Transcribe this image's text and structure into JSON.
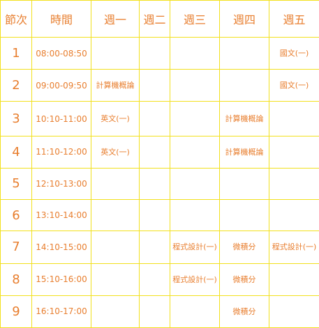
{
  "headers": [
    "節次",
    "時間",
    "週一",
    "週二",
    "週三",
    "週四",
    "週五"
  ],
  "rows": [
    {
      "period": "1",
      "time": "08:00-08:50",
      "mon": "",
      "tue": "",
      "wed": "",
      "thu": "",
      "fri": "國文(一)"
    },
    {
      "period": "2",
      "time": "09:00-09:50",
      "mon": "計算機概論",
      "tue": "",
      "wed": "",
      "thu": "",
      "fri": "國文(一)"
    },
    {
      "period": "3",
      "time": "10:10-11:00",
      "mon": "英文(一)",
      "tue": "",
      "wed": "",
      "thu": "計算機概論",
      "fri": ""
    },
    {
      "period": "4",
      "time": "11:10-12:00",
      "mon": "英文(一)",
      "tue": "",
      "wed": "",
      "thu": "計算機概論",
      "fri": ""
    },
    {
      "period": "5",
      "time": "12:10-13:00",
      "mon": "",
      "tue": "",
      "wed": "",
      "thu": "",
      "fri": ""
    },
    {
      "period": "6",
      "time": "13:10-14:00",
      "mon": "",
      "tue": "",
      "wed": "",
      "thu": "",
      "fri": ""
    },
    {
      "period": "7",
      "time": "14:10-15:00",
      "mon": "",
      "tue": "",
      "wed": "程式設計(一)",
      "thu": "微積分",
      "fri": "程式設計(一)"
    },
    {
      "period": "8",
      "time": "15:10-16:00",
      "mon": "",
      "tue": "",
      "wed": "程式設計(一)",
      "thu": "微積分",
      "fri": ""
    },
    {
      "period": "9",
      "time": "16:10-17:00",
      "mon": "",
      "tue": "",
      "wed": "",
      "thu": "微積分",
      "fri": ""
    }
  ]
}
